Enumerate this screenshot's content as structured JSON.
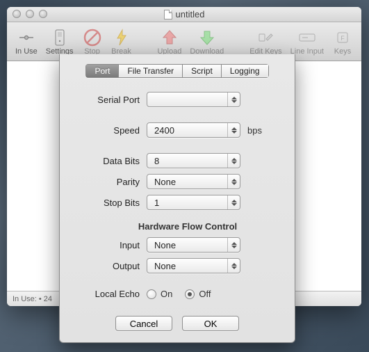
{
  "window": {
    "title": "untitled"
  },
  "toolbar": {
    "in_use": "In Use",
    "settings": "Settings",
    "stop": "Stop",
    "break": "Break",
    "upload": "Upload",
    "download": "Download",
    "edit_keys": "Edit Keys",
    "line_input": "Line Input",
    "keys": "Keys"
  },
  "status": "In Use:   •  24",
  "tabs": {
    "port": "Port",
    "file_transfer": "File Transfer",
    "script": "Script",
    "logging": "Logging"
  },
  "form": {
    "serial_port_label": "Serial Port",
    "serial_port_value": "",
    "speed_label": "Speed",
    "speed_value": "2400",
    "speed_unit": "bps",
    "data_bits_label": "Data Bits",
    "data_bits_value": "8",
    "parity_label": "Parity",
    "parity_value": "None",
    "stop_bits_label": "Stop Bits",
    "stop_bits_value": "1",
    "hw_flow_title": "Hardware Flow Control",
    "input_label": "Input",
    "input_value": "None",
    "output_label": "Output",
    "output_value": "None",
    "local_echo_label": "Local Echo",
    "on_label": "On",
    "off_label": "Off",
    "local_echo_value": "Off"
  },
  "buttons": {
    "cancel": "Cancel",
    "ok": "OK"
  }
}
